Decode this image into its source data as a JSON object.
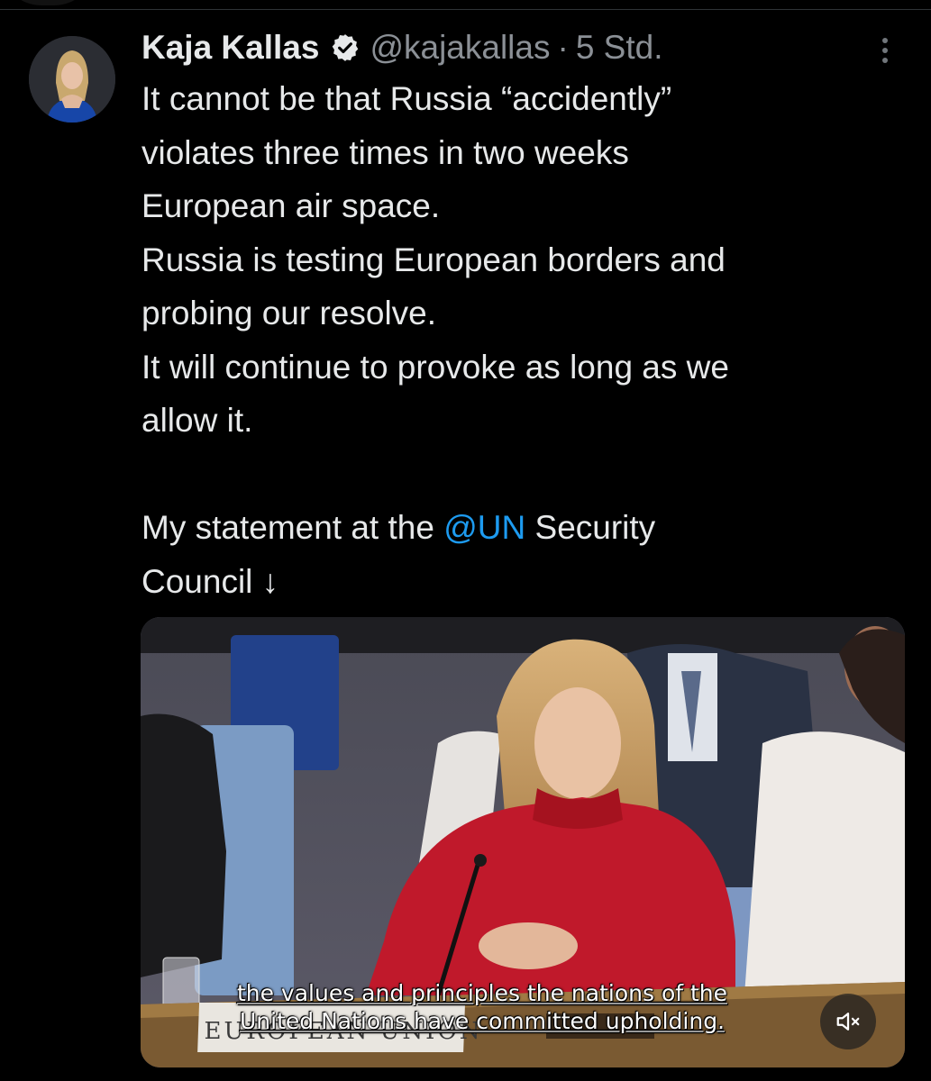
{
  "tweet": {
    "author": {
      "display_name": "Kaja Kallas",
      "handle": "@kajakallas",
      "verified": true
    },
    "separator": "·",
    "timestamp": "5 Std.",
    "text_lines": [
      "It cannot be that Russia “accidently”",
      "violates three times in two weeks",
      "European air space.",
      "Russia is testing European borders and",
      "probing our resolve.",
      "It will continue to provoke as long as we",
      "allow it.",
      ""
    ],
    "statement": {
      "before": "My statement at the ",
      "mention": "@UN",
      "after": " Security",
      "line2": "Council ↓"
    }
  },
  "media": {
    "caption_lines": [
      "the values and principles the nations of the",
      "United Nations have committed upholding."
    ],
    "nameplate": "EUROPEAN UNION",
    "mute_icon": "speaker-muted-icon"
  },
  "icons": {
    "verified": "verified-badge-icon",
    "more": "more-options-icon"
  },
  "colors": {
    "background": "#000000",
    "text": "#e7e9ea",
    "secondary": "#8b9096",
    "link": "#1d9bf0",
    "sweater": "#c0192b"
  }
}
